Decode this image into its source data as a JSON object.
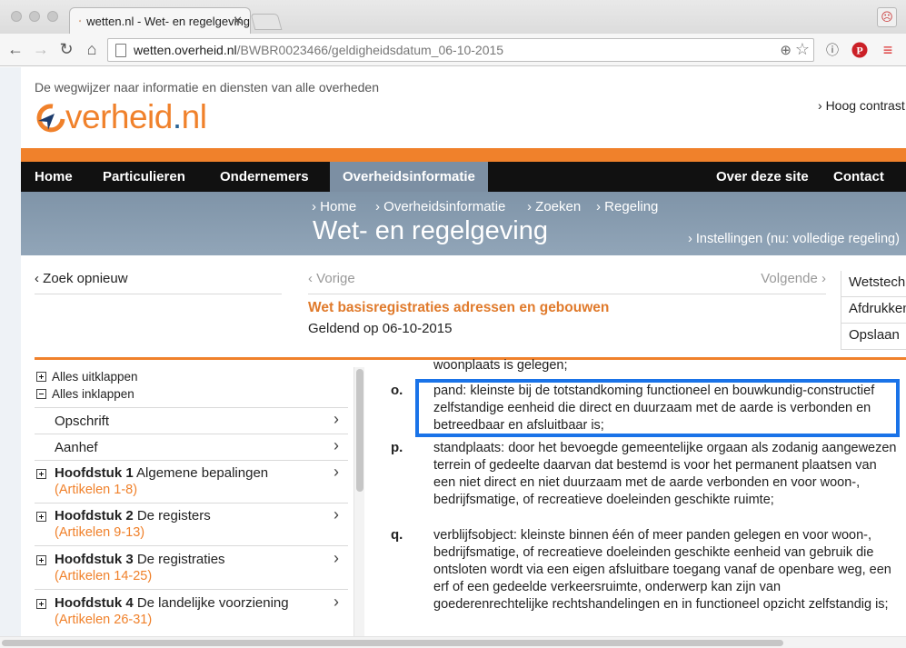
{
  "browser": {
    "tab_title": "wetten.nl - Wet- en regelgeving",
    "url_host": "wetten.overheid.nl",
    "url_path": "/BWBR0023466/geldigheidsdatum_06-10-2015",
    "icons": [
      "back-icon",
      "forward-icon",
      "reload-icon",
      "home-icon",
      "zoom-icon",
      "star-icon",
      "profile-icon",
      "extension-icon",
      "pinterest-icon",
      "menu-icon"
    ]
  },
  "site": {
    "tagline": "De wegwijzer naar informatie en diensten van alle overheden",
    "logo_main": "verheid",
    "logo_dot": ".",
    "logo_nl": "nl",
    "high_contrast": "Hoog contrast",
    "brand_color": "#f0812b"
  },
  "nav": {
    "home": "Home",
    "particulieren": "Particulieren",
    "ondernemers": "Ondernemers",
    "overheidsinformatie": "Overheidsinformatie",
    "over": "Over deze site",
    "contact": "Contact"
  },
  "banner": {
    "crumbs": [
      "Home",
      "Overheidsinformatie",
      "Zoeken",
      "Regeling"
    ],
    "title": "Wet- en regelgeving",
    "settings": "Instellingen (nu: volledige regeling)"
  },
  "doc": {
    "search_again": "Zoek opnieuw",
    "prev": "Vorige",
    "next": "Volgende",
    "title": "Wet basisregistraties adressen en gebouwen",
    "date": "Geldend op 06-10-2015",
    "tools": [
      "Wetstechnische informatie",
      "Afdrukken",
      "Opslaan"
    ]
  },
  "sidebar": {
    "expand_all": "Alles uitklappen",
    "collapse_all": "Alles inklappen",
    "items": [
      {
        "label": "Opschrift"
      },
      {
        "label": "Aanhef"
      },
      {
        "bold": "Hoofdstuk 1",
        "label": "Algemene bepalingen",
        "sub": "(Artikelen 1-8)"
      },
      {
        "bold": "Hoofdstuk 2",
        "label": "De registers",
        "sub": "(Artikelen 9-13)"
      },
      {
        "bold": "Hoofdstuk 3",
        "label": "De registraties",
        "sub": "(Artikelen 14-25)"
      },
      {
        "bold": "Hoofdstuk 4",
        "label": "De landelijke voorziening",
        "sub": "(Artikelen 26-31)"
      }
    ]
  },
  "content": {
    "partial_top": "woonplaats is gelegen;",
    "definitions": [
      {
        "letter": "o.",
        "text": "pand: kleinste bij de totstandkoming functioneel en bouwkundig-constructief zelfstandige eenheid die direct en duurzaam met de aarde is verbonden en betreedbaar en afsluitbaar is;"
      },
      {
        "letter": "p.",
        "text": "standplaats: door het bevoegde gemeentelijke orgaan als zodanig aangewezen terrein of gedeelte daarvan dat bestemd is voor het permanent plaatsen van een niet direct en niet duurzaam met de aarde verbonden en voor woon-, bedrijfsmatige, of recreatieve doeleinden geschikte ruimte;"
      },
      {
        "letter": "q.",
        "text": "verblijfsobject: kleinste binnen één of meer panden gelegen en voor woon-, bedrijfsmatige, of recreatieve doeleinden geschikte eenheid van gebruik die ontsloten wordt via een eigen afsluitbare toegang vanaf de openbare weg, een erf of een gedeelde verkeersruimte, onderwerp kan zijn van goederenrechtelijke rechtshandelingen en in functioneel opzicht zelfstandig is;"
      }
    ],
    "highlight_color": "#1a73e8"
  }
}
